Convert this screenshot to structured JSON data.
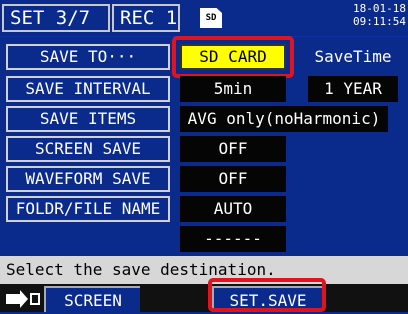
{
  "topbar": {
    "set_label": "SET  3/7",
    "rec_label": "REC  1",
    "sd_icon_text": "SD",
    "date": "18-01-18",
    "time": "09:11:54"
  },
  "rows": [
    {
      "label": "SAVE TO···",
      "value": "SD CARD"
    },
    {
      "label": "SAVE INTERVAL",
      "value": "5min"
    },
    {
      "label": "SAVE ITEMS",
      "value": "AVG only(noHarmonic)"
    },
    {
      "label": "SCREEN SAVE",
      "value": "OFF"
    },
    {
      "label": "WAVEFORM SAVE",
      "value": "OFF"
    },
    {
      "label": "FOLDR/FILE NAME",
      "value": "AUTO"
    },
    {
      "label": "",
      "value": "------"
    }
  ],
  "save_time": {
    "label": "SaveTime",
    "value": "1 YEAR"
  },
  "message": "Select the save destination.",
  "bottombar": {
    "screen_label": "SCREEN",
    "set_save_label": "SET.SAVE"
  },
  "colors": {
    "background": "#0a2a8c",
    "highlight": "#ffff00",
    "callout": "#e0141e"
  }
}
